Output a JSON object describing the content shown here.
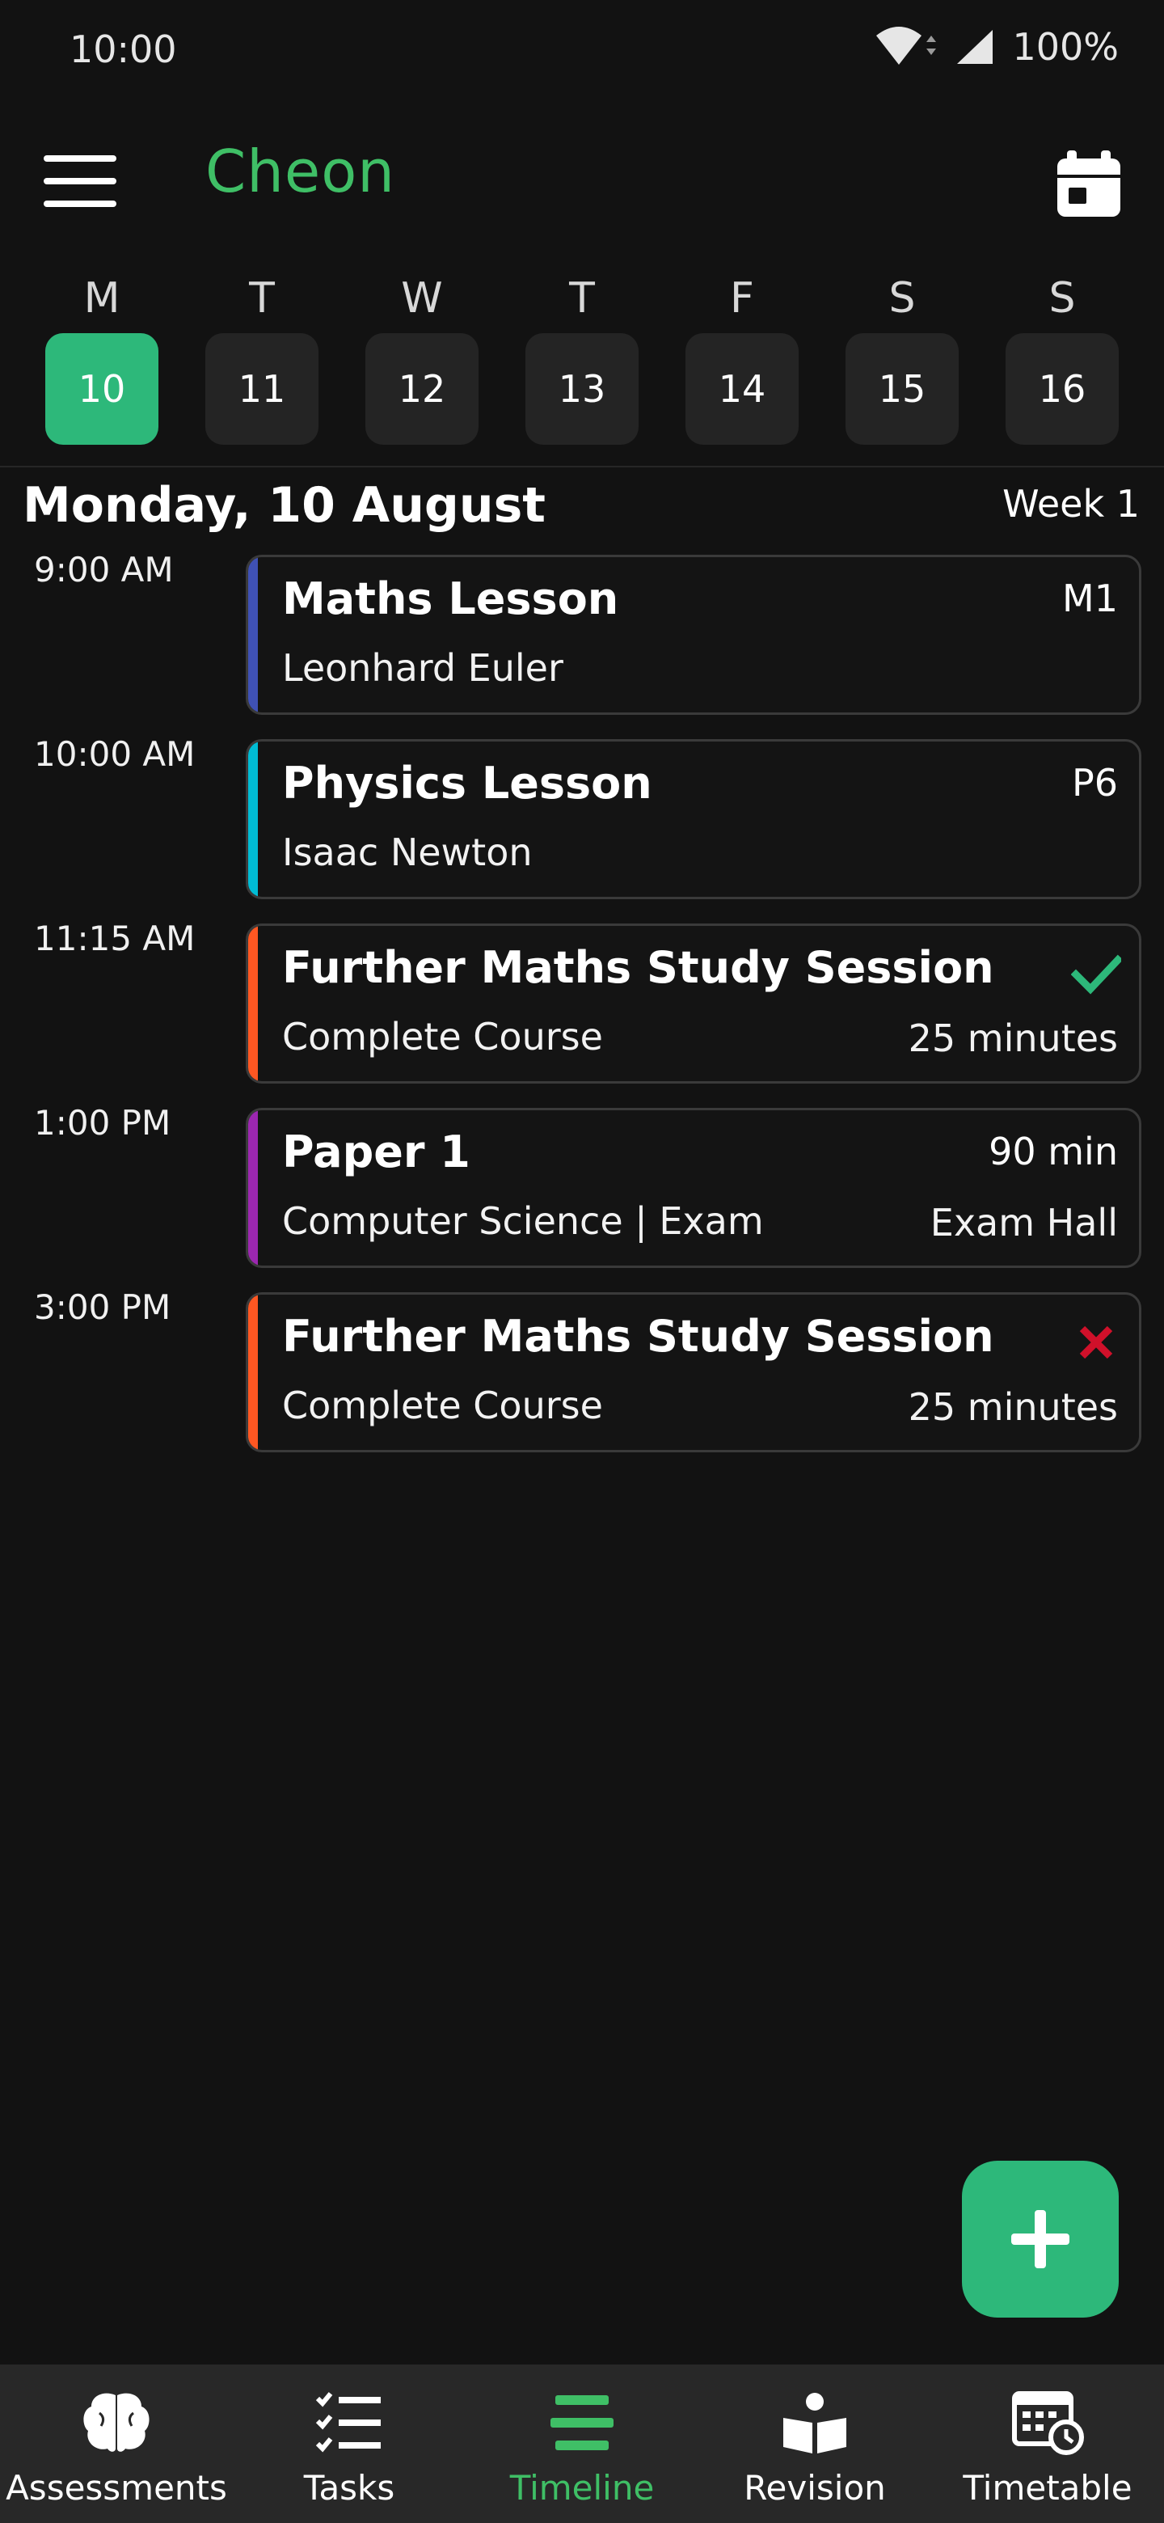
{
  "status_bar": {
    "time": "10:00",
    "battery": "100%"
  },
  "app": {
    "title": "Cheon",
    "accent_color": "#3fbf66"
  },
  "week_strip": {
    "days": [
      {
        "letter": "M",
        "date": "10",
        "selected": true
      },
      {
        "letter": "T",
        "date": "11",
        "selected": false
      },
      {
        "letter": "W",
        "date": "12",
        "selected": false
      },
      {
        "letter": "T",
        "date": "13",
        "selected": false
      },
      {
        "letter": "F",
        "date": "14",
        "selected": false
      },
      {
        "letter": "S",
        "date": "15",
        "selected": false
      },
      {
        "letter": "S",
        "date": "16",
        "selected": false
      }
    ]
  },
  "day_header": {
    "date": "Monday, 10 August",
    "week": "Week 1"
  },
  "events": [
    {
      "time": "9:00 AM",
      "title": "Maths Lesson",
      "subtitle": "Leonhard Euler",
      "right_top": "M1",
      "right_bottom": "",
      "accent": "#3f51b5",
      "status": ""
    },
    {
      "time": "10:00 AM",
      "title": "Physics Lesson",
      "subtitle": "Isaac Newton",
      "right_top": "P6",
      "right_bottom": "",
      "accent": "#00bcd4",
      "status": ""
    },
    {
      "time": "11:15 AM",
      "title": "Further Maths Study Session",
      "subtitle": "Complete Course",
      "right_top": "",
      "right_bottom": "25 minutes",
      "accent": "#ff5722",
      "status": "check"
    },
    {
      "time": "1:00 PM",
      "title": "Paper 1",
      "subtitle": "Computer Science | Exam",
      "right_top": "90 min",
      "right_bottom": "Exam Hall",
      "accent": "#9c27b0",
      "status": ""
    },
    {
      "time": "3:00 PM",
      "title": "Further Maths Study Session",
      "subtitle": "Complete Course",
      "right_top": "",
      "right_bottom": "25 minutes",
      "accent": "#ff5722",
      "status": "cross"
    }
  ],
  "bottom_nav": {
    "items": [
      {
        "label": "Assessments",
        "icon": "brain-icon",
        "active": false
      },
      {
        "label": "Tasks",
        "icon": "checklist-icon",
        "active": false
      },
      {
        "label": "Timeline",
        "icon": "timeline-icon",
        "active": true
      },
      {
        "label": "Revision",
        "icon": "reading-icon",
        "active": false
      },
      {
        "label": "Timetable",
        "icon": "timetable-icon",
        "active": false
      }
    ]
  },
  "fab": {
    "icon": "plus-icon",
    "color": "#2db87a"
  },
  "colors": {
    "check": "#2db87a",
    "cross": "#d0102a"
  }
}
